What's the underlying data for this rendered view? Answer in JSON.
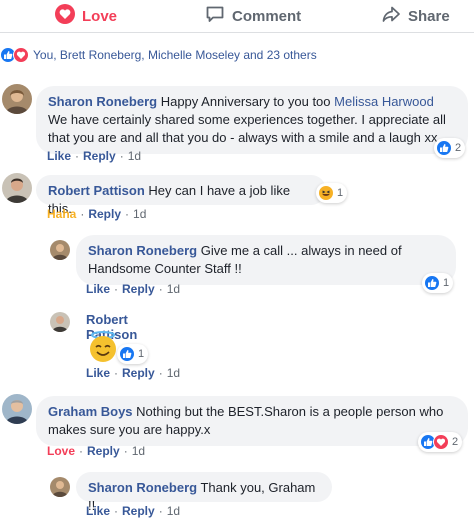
{
  "actions": {
    "love": "Love",
    "comment": "Comment",
    "share": "Share"
  },
  "summary": {
    "text": "You, Brett Roneberg, Michelle Moseley and 23 others"
  },
  "colors": {
    "link": "#385898",
    "love": "#f33e58",
    "haha": "#f7b125",
    "like": "#1877f2",
    "bubble": "#f2f3f5",
    "meta": "#606770"
  },
  "comments": [
    {
      "author": "Sharon Roneberg",
      "text_before": "Happy Anniversary to you too ",
      "mention": "Melissa Harwood",
      "text_after": " We have certainly shared some experiences together. I appreciate all that you are and all that you do - always with a smile and a laugh xx",
      "reaction_icons": [
        "like-icon"
      ],
      "reaction_count": "2",
      "meta": {
        "action": "Like",
        "reply": "Reply",
        "time": "1d"
      }
    },
    {
      "author": "Robert Pattison",
      "text": "Hey can I have a job like this.",
      "reaction_icons": [
        "haha-icon"
      ],
      "reaction_count": "1",
      "meta": {
        "action": "Haha",
        "reply": "Reply",
        "time": "1d"
      }
    },
    {
      "author": "Sharon Roneberg",
      "text": "Give me a call ... always in need of Handsome Counter Staff !!",
      "reaction_icons": [
        "like-icon"
      ],
      "reaction_count": "1",
      "meta": {
        "action": "Like",
        "reply": "Reply",
        "time": "1d"
      }
    },
    {
      "author": "Robert Pattison",
      "sticker": "angel-emoji",
      "reaction_icons": [
        "like-icon"
      ],
      "reaction_count": "1",
      "meta": {
        "action": "Like",
        "reply": "Reply",
        "time": "1d"
      }
    },
    {
      "author": "Graham Boys",
      "text": "Nothing but the BEST.Sharon is a people person who makes sure you are happy.x",
      "reaction_icons": [
        "like-icon",
        "love-icon"
      ],
      "reaction_count": "2",
      "meta": {
        "action": "Love",
        "reply": "Reply",
        "time": "1d"
      }
    },
    {
      "author": "Sharon Roneberg",
      "text": "Thank you, Graham !!",
      "meta": {
        "action": "Like",
        "reply": "Reply",
        "time": "1d"
      }
    }
  ]
}
